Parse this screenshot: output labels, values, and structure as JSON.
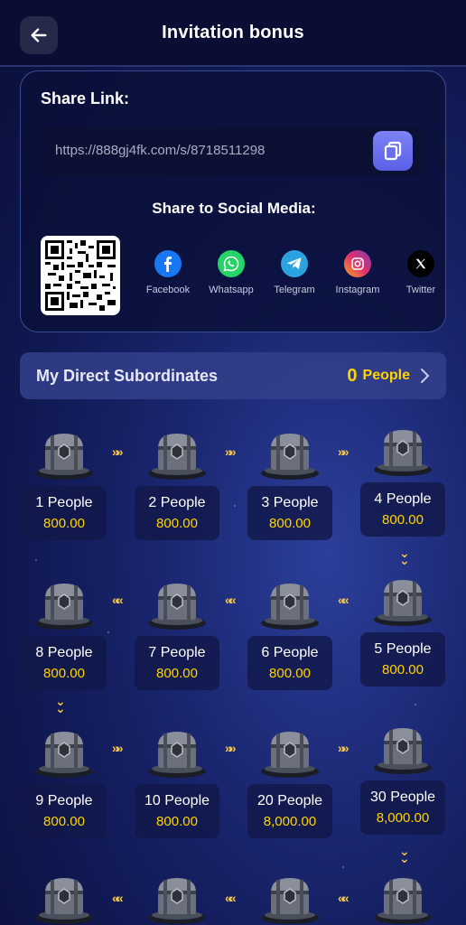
{
  "header": {
    "title": "Invitation bonus"
  },
  "share": {
    "title": "Share Link:",
    "link": "https://888gj4fk.com/s/8718511298",
    "social_title": "Share to Social Media:",
    "socials": [
      {
        "label": "Facebook",
        "icon": "facebook-icon",
        "color": "#1877f2"
      },
      {
        "label": "Whatsapp",
        "icon": "whatsapp-icon",
        "color": "#25d366"
      },
      {
        "label": "Telegram",
        "icon": "telegram-icon",
        "color": "#2aa3e0"
      },
      {
        "label": "Instagram",
        "icon": "instagram-icon",
        "color": "#d6287b"
      },
      {
        "label": "Twitter",
        "icon": "x-twitter-icon",
        "color": "#000000"
      }
    ]
  },
  "subordinates": {
    "label": "My Direct Subordinates",
    "count": "0",
    "unit": "People"
  },
  "rewards": [
    {
      "people": "1 People",
      "amount": "800.00"
    },
    {
      "people": "2 People",
      "amount": "800.00"
    },
    {
      "people": "3 People",
      "amount": "800.00"
    },
    {
      "people": "4 People",
      "amount": "800.00"
    },
    {
      "people": "5 People",
      "amount": "800.00"
    },
    {
      "people": "6 People",
      "amount": "800.00"
    },
    {
      "people": "7 People",
      "amount": "800.00"
    },
    {
      "people": "8 People",
      "amount": "800.00"
    },
    {
      "people": "9 People",
      "amount": "800.00"
    },
    {
      "people": "10 People",
      "amount": "800.00"
    },
    {
      "people": "20 People",
      "amount": "8,000.00"
    },
    {
      "people": "30 People",
      "amount": "8,000.00"
    }
  ],
  "colors": {
    "accent": "#ffd400",
    "copy_button": "#6a6ff0",
    "header_bg": "#0a0e34"
  }
}
